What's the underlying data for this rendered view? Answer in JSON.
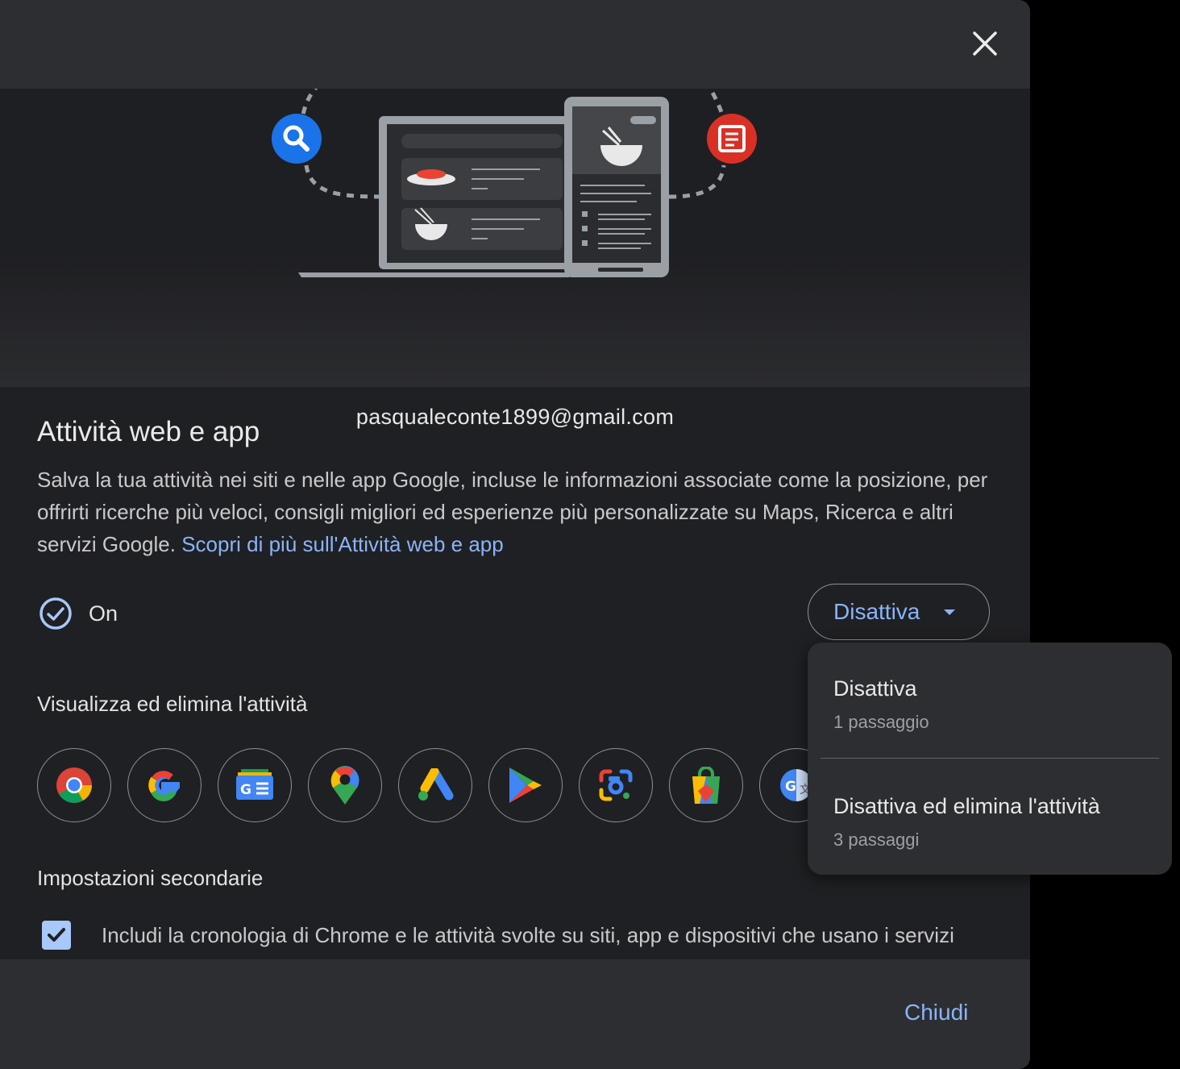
{
  "dialog": {
    "close_label": "close",
    "email": "pasqualeconte1899@gmail.com",
    "title": "Attività web e app",
    "description": "Salva la tua attività nei siti e nelle app Google, incluse le informazioni associate come la posizione, per offrirti ricerche più veloci, consigli migliori ed esperienze più personalizzate su Maps, Ricerca e altri servizi Google.",
    "learn_more_link": "Scopri di più sull'Attività web e app",
    "status": "On",
    "disattiva_button": "Disattiva",
    "view_delete_heading": "Visualizza ed elimina l'attività",
    "apps": [
      "Chrome",
      "Google",
      "Google News",
      "Maps",
      "Google Ads",
      "Play",
      "Lens",
      "Shopping",
      "Translate"
    ],
    "secondary_heading": "Impostazioni secondarie",
    "checkbox_label": "Includi la cronologia di Chrome e le attività svolte su siti, app e dispositivi che usano i servizi Google",
    "checkbox_checked": true,
    "close_button": "Chiudi"
  },
  "menu": {
    "items": [
      {
        "label": "Disattiva",
        "sub": "1 passaggio"
      },
      {
        "label": "Disattiva ed elimina l'attività",
        "sub": "3 passaggi"
      }
    ]
  },
  "colors": {
    "accent": "#8ab4f8",
    "dialog_bg": "#1f2023",
    "bar_bg": "#2d2e31"
  }
}
